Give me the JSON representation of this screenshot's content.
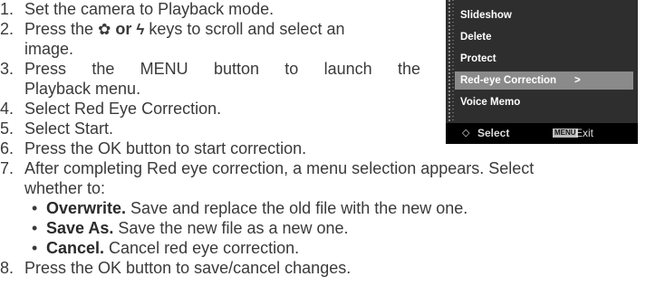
{
  "steps": [
    {
      "num": "1.",
      "text": "Set the camera to Playback mode."
    },
    {
      "num": "2.",
      "line1_a": "Press the",
      "line1_b": "or",
      "line1_c": "keys to scroll and select an",
      "line2": "image."
    },
    {
      "num": "3.",
      "line1_words": [
        "Press",
        "the",
        "MENU",
        "button",
        "to",
        "launch",
        "the"
      ],
      "line2": "Playback menu."
    },
    {
      "num": "4.",
      "text": "Select Red Eye Correction."
    },
    {
      "num": "5.",
      "text": "Select Start."
    },
    {
      "num": "6.",
      "text": "Press the OK button to start correction."
    },
    {
      "num": "7.",
      "line1": "After completing Red eye correction, a menu selection appears. Select",
      "line2": "whether to:"
    },
    {
      "num": "8.",
      "text": "Press the OK button to save/cancel changes."
    }
  ],
  "options": [
    {
      "bullet": "•",
      "term": "Overwrite.",
      "desc": " Save and replace the old file with the new one."
    },
    {
      "bullet": "•",
      "term": "Save As.",
      "desc": " Save the new file as a new one."
    },
    {
      "bullet": "•",
      "term": "Cancel.",
      "desc": " Cancel red eye correction."
    }
  ],
  "key_icons": {
    "left": "macro-flower-icon",
    "right": "flash-icon",
    "left_glyph": "✿",
    "right_glyph": "ϟ"
  },
  "camera_menu": {
    "items": [
      "Slideshow",
      "Delete",
      "Protect",
      "Red-eye Correction",
      "Voice Memo"
    ],
    "selected_index": 3,
    "selected_arrow": ">",
    "footer": {
      "nav_glyph": "◇",
      "select_label": "Select",
      "menu_key": "MENU",
      "exit_label": "Exit"
    },
    "colors": {
      "background": "#2e2e2e",
      "highlight": "#8a8a8a",
      "footer": "#000000"
    }
  }
}
